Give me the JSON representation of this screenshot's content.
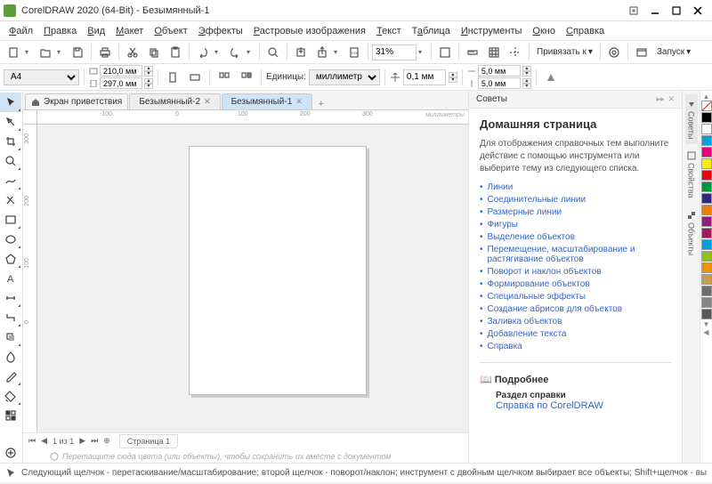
{
  "title": "CorelDRAW 2020 (64-Bit) - Безымянный-1",
  "menu": [
    "Файл",
    "Правка",
    "Вид",
    "Макет",
    "Объект",
    "Эффекты",
    "Растровые изображения",
    "Текст",
    "Таблица",
    "Инструменты",
    "Окно",
    "Справка"
  ],
  "zoom": "31%",
  "snap": "Привязать к",
  "launch": "Запуск",
  "prop": {
    "paper": "A4",
    "width": "210,0 мм",
    "height": "297,0 мм",
    "units_label": "Единицы:",
    "units": "миллиметры",
    "nudge": "0,1 мм",
    "dup_x": "5,0 мм",
    "dup_y": "5,0 мм"
  },
  "tabs": {
    "welcome": "Экран приветствия",
    "doc2": "Безымянный-2",
    "doc1": "Безымянный-1"
  },
  "ruler_unit": "миллиметры",
  "page": {
    "counter": "1 из 1",
    "name": "Страница 1"
  },
  "drag_hint": "Перетащите сюда цвета (или объекты), чтобы сохранить их вместе с документом",
  "hints": {
    "title": "Советы",
    "heading": "Домашняя страница",
    "intro": "Для отображения справочных тем выполните действие с помощью инструмента или выберите тему из следующего списка.",
    "topics": [
      "Линии",
      "Соединительные линии",
      "Размерные линии",
      "Фигуры",
      "Выделение объектов",
      "Перемещение, масштабирование и растягивание объектов",
      "Поворот и наклон объектов",
      "Формирование объектов",
      "Специальные эффекты",
      "Создание абрисов для объектов",
      "Заливка объектов",
      "Добавление текста",
      "Справка"
    ],
    "more": "Подробнее",
    "help_section": "Раздел справки",
    "help_link": "Справка по CorelDRAW"
  },
  "sidetabs": {
    "hints": "Советы",
    "props": "Свойства",
    "objects": "Объекты"
  },
  "colors": [
    "#000000",
    "#ffffff",
    "#00a0e3",
    "#e6007e",
    "#ffed00",
    "#e30613",
    "#009640",
    "#312783",
    "#ef7d00",
    "#951b81",
    "#a3195b",
    "#009fe3",
    "#95c11f",
    "#f39200",
    "#c8a055",
    "#706f6f",
    "#868686",
    "#575756"
  ],
  "status": "Следующий щелчок - перетаскивание/масштабирование; второй щелчок - поворот/наклон; инструмент с двойным щелчком выбирает все объекты; Shift+щелчок - выб"
}
